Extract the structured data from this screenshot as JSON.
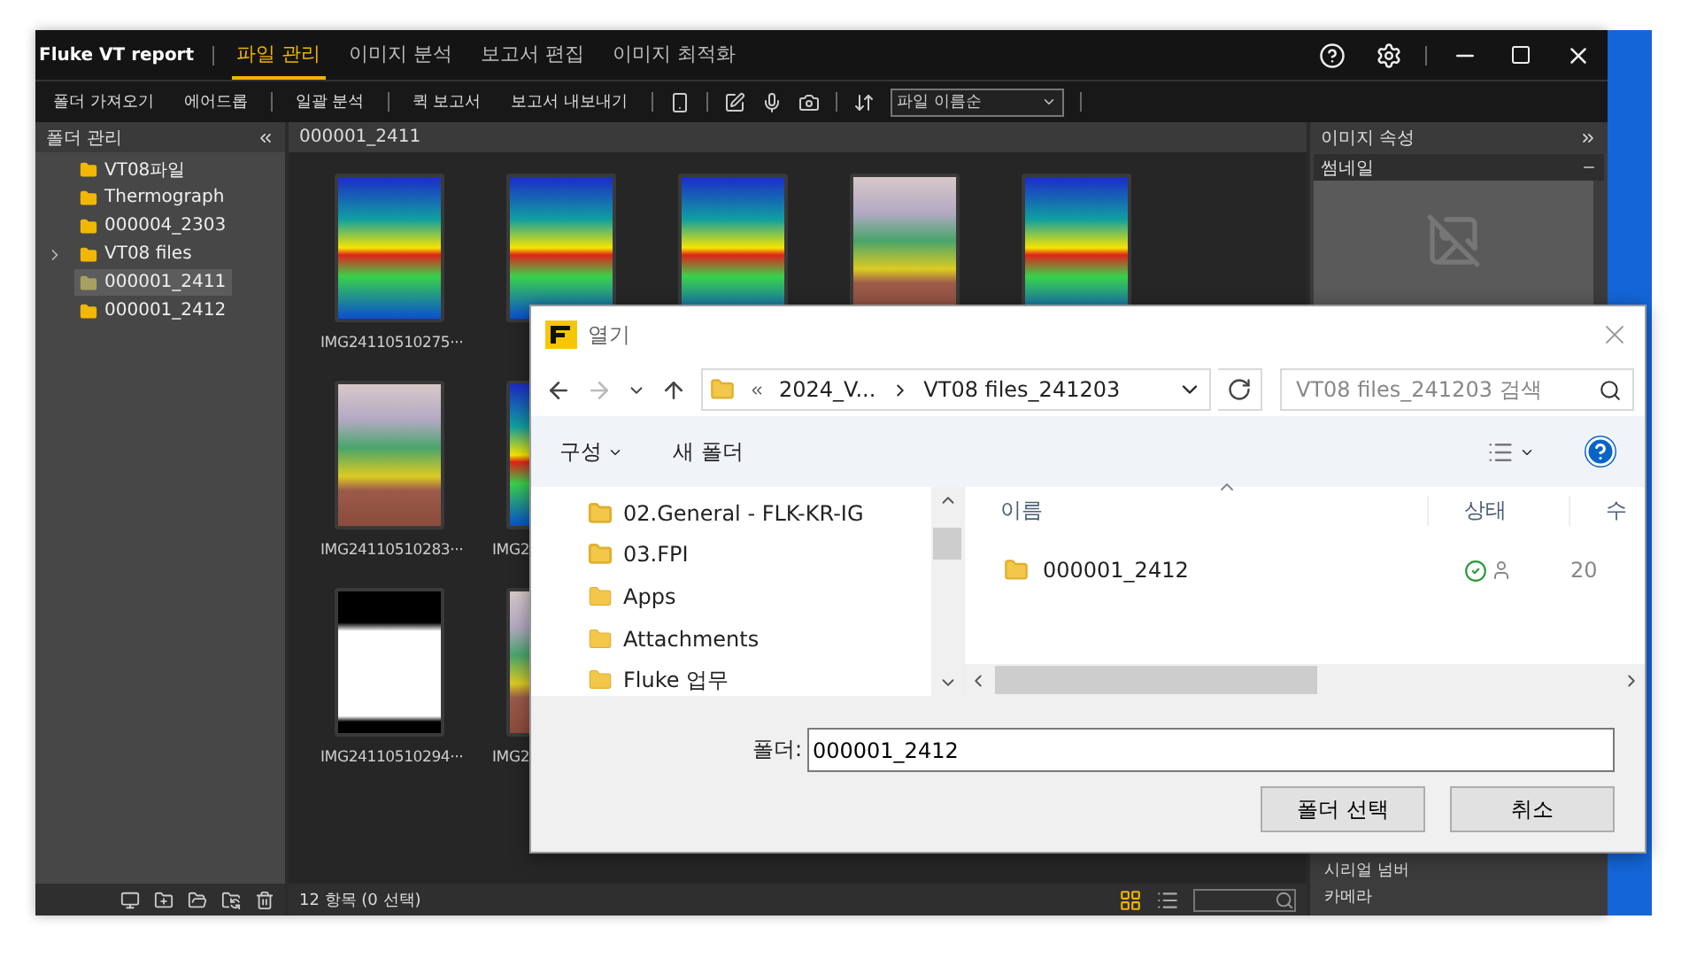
{
  "app": {
    "title": "Fluke VT report",
    "tabs": [
      {
        "label": "파일 관리",
        "selected": true
      },
      {
        "label": "이미지 분석",
        "selected": false
      },
      {
        "label": "보고서 편집",
        "selected": false
      },
      {
        "label": "이미지 최적화",
        "selected": false
      }
    ]
  },
  "toolbar": {
    "buttons": [
      "폴더 가져오기",
      "에어드롭",
      "일괄 분석",
      "퀵 보고서",
      "보고서 내보내기"
    ],
    "sort": {
      "value": "파일 이름순"
    }
  },
  "sidebar": {
    "title": "폴더 관리",
    "items": [
      {
        "label": "VT08파일",
        "kind": "leaf",
        "selected": false
      },
      {
        "label": "Thermograph",
        "kind": "leaf",
        "selected": false
      },
      {
        "label": "000004_2303",
        "kind": "leaf",
        "selected": false
      },
      {
        "label": "VT08 files",
        "kind": "group",
        "selected": false
      },
      {
        "label": "000001_2411",
        "kind": "leaf",
        "selected": true
      },
      {
        "label": "000001_2412",
        "kind": "leaf",
        "selected": false
      }
    ]
  },
  "gallery": {
    "path": "000001_2411",
    "rows": [
      [
        {
          "kind": "thermal",
          "label": "IMG24110510275···"
        },
        {
          "kind": "thermal"
        },
        {
          "kind": "thermal"
        },
        {
          "kind": "overlay"
        },
        {
          "kind": "thermal"
        }
      ],
      [
        {
          "kind": "overlay",
          "label": "IMG24110510283···"
        },
        {
          "kind": "thermal",
          "label": "IMG2"
        }
      ],
      [
        {
          "kind": "hot",
          "label": "IMG24110510294···"
        },
        {
          "kind": "overlay",
          "label": "IMG2"
        }
      ]
    ],
    "status": "12 항목 (0 선택)",
    "views": [
      {
        "kind": "grid",
        "selected": true
      },
      {
        "kind": "list",
        "selected": false
      }
    ]
  },
  "properties": {
    "title": "이미지 속성",
    "section": "썸네일",
    "fields": [
      "시리얼 넘버",
      "카메라"
    ]
  },
  "dialog": {
    "title": "열기",
    "back_disabled": false,
    "forward_disabled": true,
    "breadcrumb": [
      "2024_V...",
      "VT08 files_241203"
    ],
    "search": {
      "placeholder": "VT08 files_241203 검색"
    },
    "commands": [
      "구성",
      "새 폴더"
    ],
    "nav_items": [
      {
        "label": "02.General - FLK-KR-IG",
        "kind": "shared"
      },
      {
        "label": "03.FPI",
        "kind": "shared"
      },
      {
        "label": "Apps",
        "kind": "folder"
      },
      {
        "label": "Attachments",
        "kind": "folder"
      },
      {
        "label": "Fluke 업무",
        "kind": "folder"
      }
    ],
    "columns": [
      "이름",
      "상태",
      "수"
    ],
    "rows": [
      {
        "name": "000001_2412",
        "synced": true,
        "column_3": "20"
      }
    ],
    "folder_label": "폴더:",
    "folder_value": "000001_2412",
    "buttons": [
      "폴더 선택",
      "취소"
    ]
  }
}
